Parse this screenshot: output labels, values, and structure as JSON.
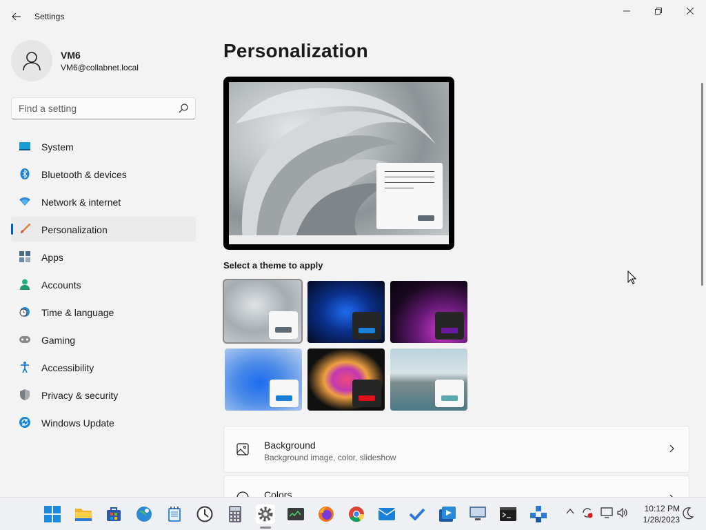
{
  "window": {
    "title": "Settings",
    "controls": [
      "minimize",
      "maximize",
      "close"
    ]
  },
  "profile": {
    "name": "VM6",
    "email": "VM6@collabnet.local"
  },
  "search": {
    "placeholder": "Find a setting",
    "value": ""
  },
  "sidebar": {
    "items": [
      {
        "label": "System",
        "icon": "system-icon"
      },
      {
        "label": "Bluetooth & devices",
        "icon": "bluetooth-icon"
      },
      {
        "label": "Network & internet",
        "icon": "network-icon"
      },
      {
        "label": "Personalization",
        "icon": "brush-icon",
        "active": true
      },
      {
        "label": "Apps",
        "icon": "apps-icon"
      },
      {
        "label": "Accounts",
        "icon": "accounts-icon"
      },
      {
        "label": "Time & language",
        "icon": "clock-globe-icon"
      },
      {
        "label": "Gaming",
        "icon": "gamepad-icon"
      },
      {
        "label": "Accessibility",
        "icon": "accessibility-icon"
      },
      {
        "label": "Privacy & security",
        "icon": "shield-icon"
      },
      {
        "label": "Windows Update",
        "icon": "update-icon"
      }
    ]
  },
  "main": {
    "title": "Personalization",
    "theme_heading": "Select a theme to apply",
    "themes": [
      {
        "name": "windows-light",
        "selected": true
      },
      {
        "name": "windows-dark",
        "selected": false
      },
      {
        "name": "glow",
        "selected": false
      },
      {
        "name": "windows-bloom-light",
        "selected": false
      },
      {
        "name": "captured-motion",
        "selected": false
      },
      {
        "name": "flow",
        "selected": false
      }
    ],
    "cards": [
      {
        "title": "Background",
        "subtitle": "Background image, color, slideshow",
        "icon": "picture-icon"
      },
      {
        "title": "Colors",
        "subtitle": "",
        "icon": "palette-icon"
      }
    ]
  },
  "taskbar": {
    "apps": [
      "start",
      "file-explorer",
      "microsoft-store",
      "maps",
      "notepad",
      "clock",
      "calculator",
      "settings",
      "task-manager",
      "firefox",
      "chrome",
      "mail",
      "todo",
      "media-player",
      "remote-desktop",
      "terminal",
      "network-app"
    ],
    "active_app": "settings",
    "clock_time": "10:12 PM",
    "clock_date": "1/28/2023"
  },
  "colors": {
    "accent": "#005fb8",
    "background": "#f3f3f3",
    "card": "#fbfbfb"
  }
}
